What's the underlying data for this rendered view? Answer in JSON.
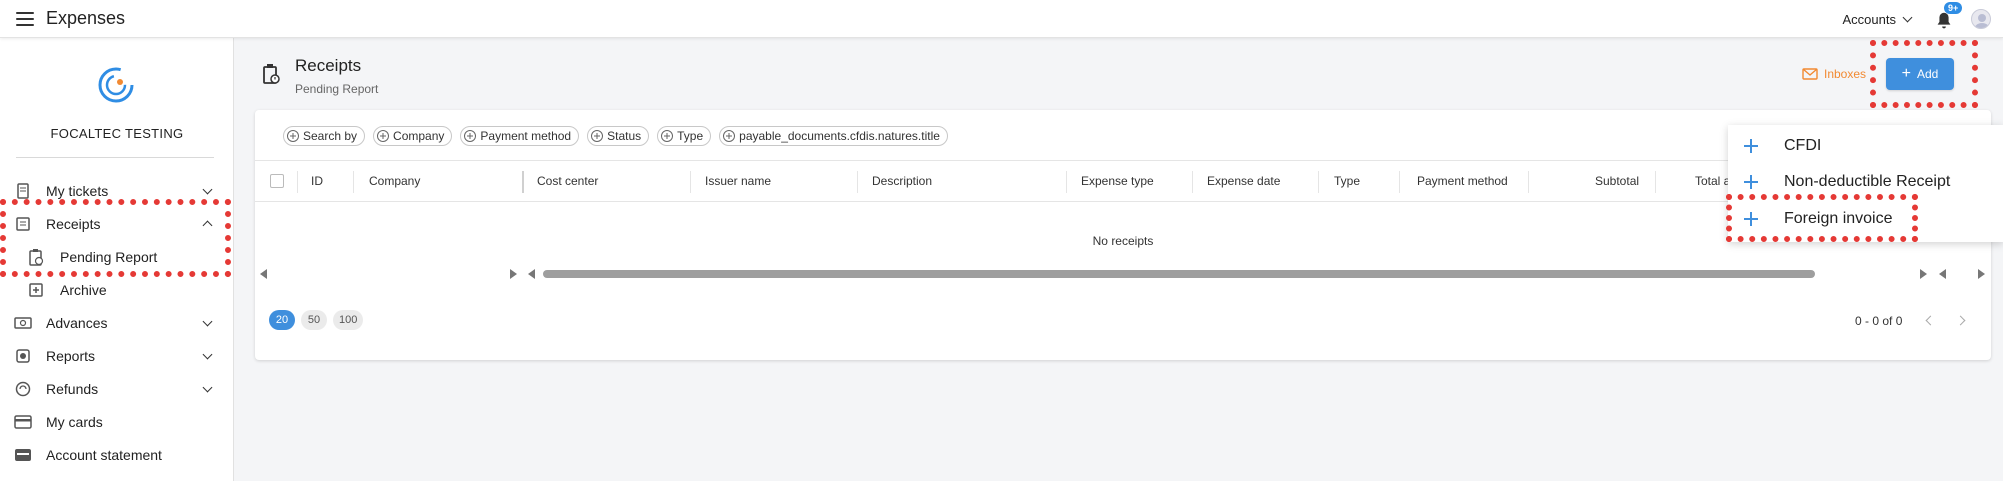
{
  "app": {
    "title": "Expenses"
  },
  "topbar": {
    "accounts_label": "Accounts",
    "notifications_badge": "9+"
  },
  "sidebar": {
    "company_name": "FOCALTEC TESTING",
    "items": [
      {
        "label": "My tickets"
      },
      {
        "label": "Receipts"
      },
      {
        "label": "Pending Report"
      },
      {
        "label": "Archive"
      },
      {
        "label": "Advances"
      },
      {
        "label": "Reports"
      },
      {
        "label": "Refunds"
      },
      {
        "label": "My cards"
      },
      {
        "label": "Account statement"
      }
    ]
  },
  "page": {
    "title": "Receipts",
    "subtitle": "Pending Report",
    "inboxes_label": "Inboxes",
    "add_label": "Add"
  },
  "filters": [
    "Search by",
    "Company",
    "Payment method",
    "Status",
    "Type",
    "payable_documents.cfdis.natures.title"
  ],
  "table": {
    "columns": [
      "ID",
      "Company",
      "Cost center",
      "Issuer name",
      "Description",
      "Expense type",
      "Expense date",
      "Type",
      "Payment method",
      "Subtotal",
      "Total a"
    ],
    "empty_message": "No receipts"
  },
  "pagination": {
    "page_sizes": [
      "20",
      "50",
      "100"
    ],
    "selected_size": "20",
    "range": "0 - 0 of 0"
  },
  "add_menu": {
    "items": [
      "CFDI",
      "Non-deductible Receipt",
      "Foreign invoice"
    ]
  },
  "colors": {
    "primary": "#3f8fdd",
    "accent_orange": "#f28a32",
    "highlight_red": "#e53935"
  }
}
